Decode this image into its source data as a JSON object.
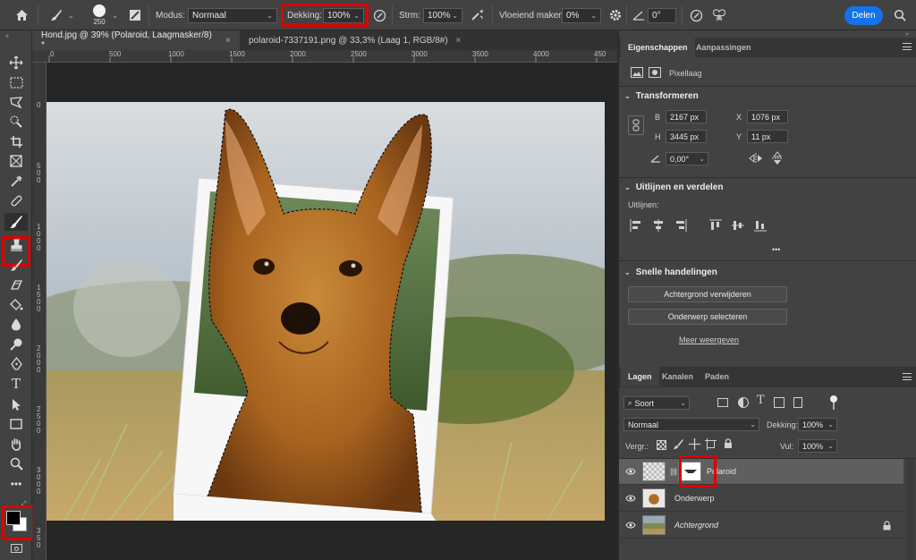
{
  "options_bar": {
    "brush_size": "250",
    "mode_label": "Modus:",
    "mode_value": "Normaal",
    "opacity_label": "Dekking:",
    "opacity_value": "100%",
    "flow_label": "Strm:",
    "flow_value": "100%",
    "smoothing_label": "Vloeiend maken:",
    "smoothing_value": "0%",
    "angle_value": "0°",
    "share_label": "Delen",
    "colors": {
      "share_bg": "#1473e6",
      "highlight": "#e00000"
    }
  },
  "doc_tabs": [
    {
      "title": "Hond.jpg @ 39% (Polaroid, Laagmasker/8) *",
      "close": "×"
    },
    {
      "title": "polaroid-7337191.png @ 33,3% (Laag 1, RGB/8#)",
      "close": "×"
    }
  ],
  "toolbar": {
    "tools": [
      "move-tool",
      "marquee-tool",
      "lasso-tool",
      "quick-select-tool",
      "crop-tool",
      "frame-tool",
      "eyedropper-tool",
      "healing-tool",
      "brush-tool",
      "stamp-tool",
      "history-brush-tool",
      "eraser-tool",
      "paint-bucket-tool",
      "blur-tool",
      "dodge-tool",
      "pen-tool",
      "type-tool",
      "path-select-tool",
      "shape-tool",
      "hand-tool",
      "zoom-tool",
      "more-tools"
    ]
  },
  "ruler": {
    "h_labels": [
      "0",
      "500",
      "1000",
      "1500",
      "2000",
      "2500",
      "3000",
      "3500",
      "4000",
      "450"
    ],
    "v_labels": [
      "0",
      "5\n0\n0",
      "1\n0\n0\n0",
      "1\n5\n0\n0",
      "2\n0\n0\n0",
      "2\n5\n0\n0",
      "3\n0\n0\n0",
      "3\n5\n0"
    ]
  },
  "properties": {
    "tabs": [
      "Eigenschappen",
      "Aanpassingen"
    ],
    "layer_type": "Pixellaag",
    "transform": {
      "title": "Transformeren",
      "w_label": "B",
      "w_value": "2167 px",
      "h_label": "H",
      "h_value": "3445 px",
      "x_label": "X",
      "x_value": "1076 px",
      "y_label": "Y",
      "y_value": "11 px",
      "angle_value": "0,00°"
    },
    "align": {
      "title": "Uitlijnen en verdelen",
      "label": "Uitlijnen:",
      "more": "•••"
    },
    "quick": {
      "title": "Snelle handelingen",
      "remove_bg": "Achtergrond verwijderen",
      "select_subject": "Onderwerp selecteren",
      "more": "Meer weergeven"
    }
  },
  "layers": {
    "tabs": [
      "Lagen",
      "Kanalen",
      "Paden"
    ],
    "filter_label": "Soort",
    "blend_value": "Normaal",
    "opacity_label": "Dekking:",
    "opacity_value": "100%",
    "lock_label": "Vergr.:",
    "fill_label": "Vul:",
    "fill_value": "100%",
    "items": [
      {
        "name": "Polaroid"
      },
      {
        "name": "Onderwerp"
      },
      {
        "name": "Achtergrond"
      }
    ]
  }
}
